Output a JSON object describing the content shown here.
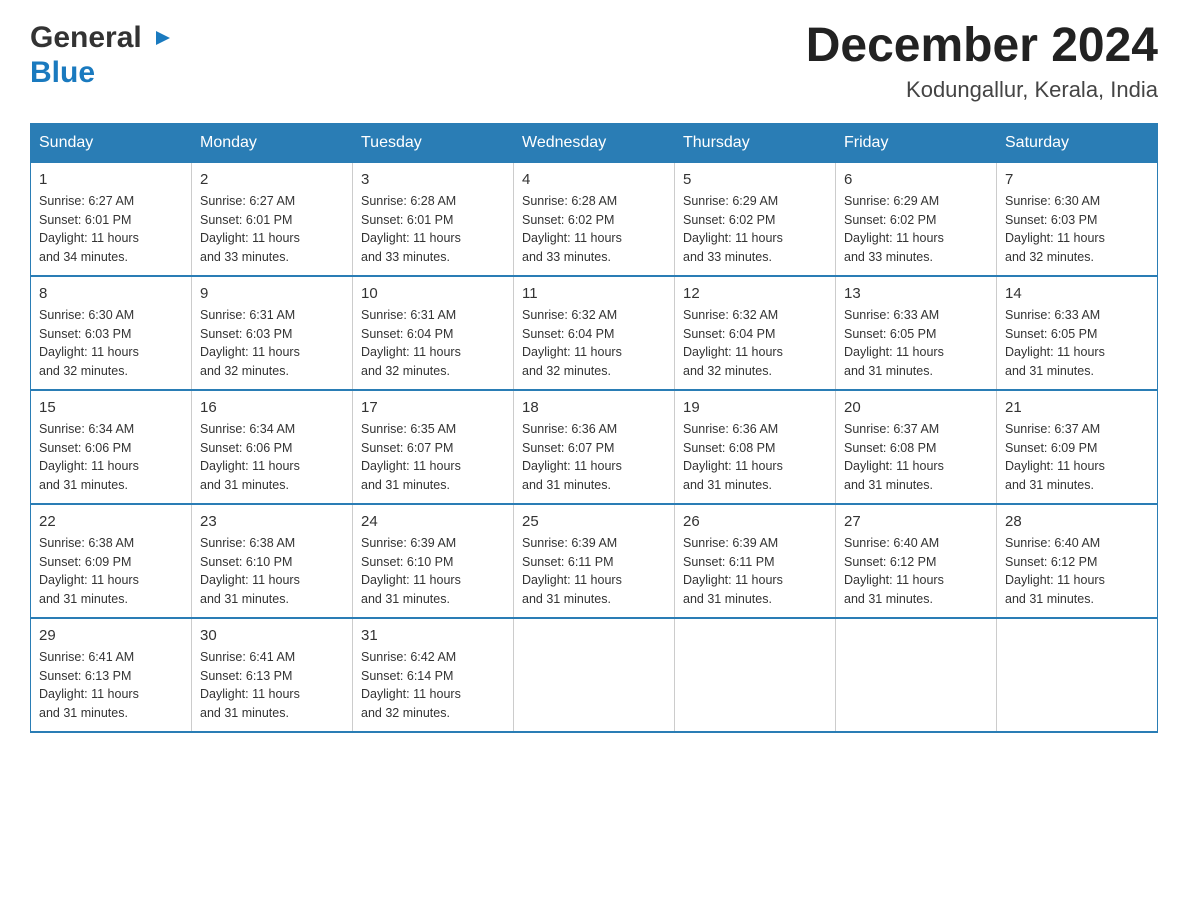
{
  "logo": {
    "general": "General",
    "blue": "Blue",
    "arrow": "▶"
  },
  "title": "December 2024",
  "location": "Kodungallur, Kerala, India",
  "days_of_week": [
    "Sunday",
    "Monday",
    "Tuesday",
    "Wednesday",
    "Thursday",
    "Friday",
    "Saturday"
  ],
  "weeks": [
    [
      {
        "day": "1",
        "sunrise": "6:27 AM",
        "sunset": "6:01 PM",
        "daylight": "11 hours and 34 minutes."
      },
      {
        "day": "2",
        "sunrise": "6:27 AM",
        "sunset": "6:01 PM",
        "daylight": "11 hours and 33 minutes."
      },
      {
        "day": "3",
        "sunrise": "6:28 AM",
        "sunset": "6:01 PM",
        "daylight": "11 hours and 33 minutes."
      },
      {
        "day": "4",
        "sunrise": "6:28 AM",
        "sunset": "6:02 PM",
        "daylight": "11 hours and 33 minutes."
      },
      {
        "day": "5",
        "sunrise": "6:29 AM",
        "sunset": "6:02 PM",
        "daylight": "11 hours and 33 minutes."
      },
      {
        "day": "6",
        "sunrise": "6:29 AM",
        "sunset": "6:02 PM",
        "daylight": "11 hours and 33 minutes."
      },
      {
        "day": "7",
        "sunrise": "6:30 AM",
        "sunset": "6:03 PM",
        "daylight": "11 hours and 32 minutes."
      }
    ],
    [
      {
        "day": "8",
        "sunrise": "6:30 AM",
        "sunset": "6:03 PM",
        "daylight": "11 hours and 32 minutes."
      },
      {
        "day": "9",
        "sunrise": "6:31 AM",
        "sunset": "6:03 PM",
        "daylight": "11 hours and 32 minutes."
      },
      {
        "day": "10",
        "sunrise": "6:31 AM",
        "sunset": "6:04 PM",
        "daylight": "11 hours and 32 minutes."
      },
      {
        "day": "11",
        "sunrise": "6:32 AM",
        "sunset": "6:04 PM",
        "daylight": "11 hours and 32 minutes."
      },
      {
        "day": "12",
        "sunrise": "6:32 AM",
        "sunset": "6:04 PM",
        "daylight": "11 hours and 32 minutes."
      },
      {
        "day": "13",
        "sunrise": "6:33 AM",
        "sunset": "6:05 PM",
        "daylight": "11 hours and 31 minutes."
      },
      {
        "day": "14",
        "sunrise": "6:33 AM",
        "sunset": "6:05 PM",
        "daylight": "11 hours and 31 minutes."
      }
    ],
    [
      {
        "day": "15",
        "sunrise": "6:34 AM",
        "sunset": "6:06 PM",
        "daylight": "11 hours and 31 minutes."
      },
      {
        "day": "16",
        "sunrise": "6:34 AM",
        "sunset": "6:06 PM",
        "daylight": "11 hours and 31 minutes."
      },
      {
        "day": "17",
        "sunrise": "6:35 AM",
        "sunset": "6:07 PM",
        "daylight": "11 hours and 31 minutes."
      },
      {
        "day": "18",
        "sunrise": "6:36 AM",
        "sunset": "6:07 PM",
        "daylight": "11 hours and 31 minutes."
      },
      {
        "day": "19",
        "sunrise": "6:36 AM",
        "sunset": "6:08 PM",
        "daylight": "11 hours and 31 minutes."
      },
      {
        "day": "20",
        "sunrise": "6:37 AM",
        "sunset": "6:08 PM",
        "daylight": "11 hours and 31 minutes."
      },
      {
        "day": "21",
        "sunrise": "6:37 AM",
        "sunset": "6:09 PM",
        "daylight": "11 hours and 31 minutes."
      }
    ],
    [
      {
        "day": "22",
        "sunrise": "6:38 AM",
        "sunset": "6:09 PM",
        "daylight": "11 hours and 31 minutes."
      },
      {
        "day": "23",
        "sunrise": "6:38 AM",
        "sunset": "6:10 PM",
        "daylight": "11 hours and 31 minutes."
      },
      {
        "day": "24",
        "sunrise": "6:39 AM",
        "sunset": "6:10 PM",
        "daylight": "11 hours and 31 minutes."
      },
      {
        "day": "25",
        "sunrise": "6:39 AM",
        "sunset": "6:11 PM",
        "daylight": "11 hours and 31 minutes."
      },
      {
        "day": "26",
        "sunrise": "6:39 AM",
        "sunset": "6:11 PM",
        "daylight": "11 hours and 31 minutes."
      },
      {
        "day": "27",
        "sunrise": "6:40 AM",
        "sunset": "6:12 PM",
        "daylight": "11 hours and 31 minutes."
      },
      {
        "day": "28",
        "sunrise": "6:40 AM",
        "sunset": "6:12 PM",
        "daylight": "11 hours and 31 minutes."
      }
    ],
    [
      {
        "day": "29",
        "sunrise": "6:41 AM",
        "sunset": "6:13 PM",
        "daylight": "11 hours and 31 minutes."
      },
      {
        "day": "30",
        "sunrise": "6:41 AM",
        "sunset": "6:13 PM",
        "daylight": "11 hours and 31 minutes."
      },
      {
        "day": "31",
        "sunrise": "6:42 AM",
        "sunset": "6:14 PM",
        "daylight": "11 hours and 32 minutes."
      },
      null,
      null,
      null,
      null
    ]
  ],
  "labels": {
    "sunrise": "Sunrise:",
    "sunset": "Sunset:",
    "daylight": "Daylight:"
  }
}
